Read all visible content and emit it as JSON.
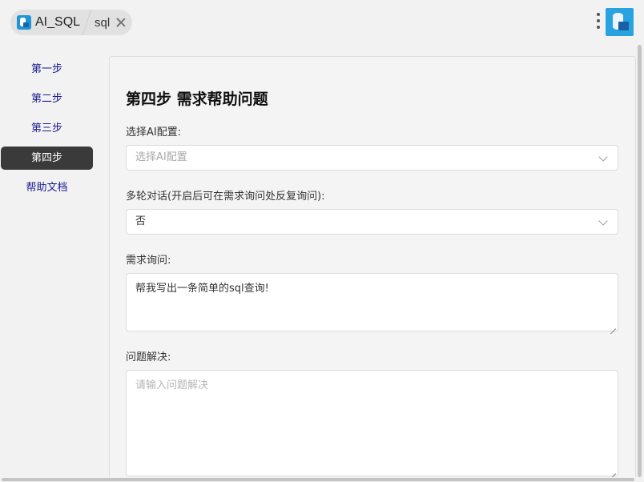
{
  "tabs": {
    "app_label": "AI_SQL",
    "sql_label": "sql"
  },
  "sidebar": {
    "items": [
      {
        "label": "第一步"
      },
      {
        "label": "第二步"
      },
      {
        "label": "第三步"
      },
      {
        "label": "第四步"
      },
      {
        "label": "帮助文档"
      }
    ],
    "active_index": 3
  },
  "main": {
    "title": "第四步 需求帮助问题",
    "ai_config": {
      "label": "选择AI配置:",
      "placeholder": "选择AI配置"
    },
    "multi_turn": {
      "label": "多轮对话(开启后可在需求询问处反复询问):",
      "value": "否"
    },
    "query": {
      "label": "需求询问:",
      "value": "帮我写出一条简单的sql查询!"
    },
    "solution": {
      "label": "问题解决:",
      "placeholder": "请输入问题解决"
    }
  },
  "colors": {
    "active_nav_bg": "#3a3a3a",
    "nav_text": "#1a1a8f",
    "brand": "#29a3df"
  }
}
